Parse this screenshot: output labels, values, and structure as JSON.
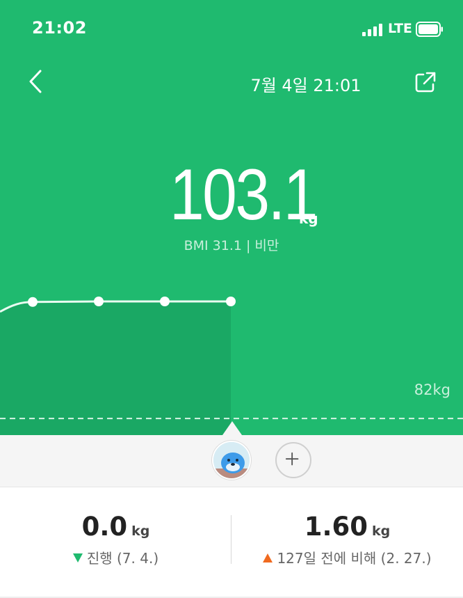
{
  "status_bar": {
    "time": "21:02",
    "network": "LTE"
  },
  "nav": {
    "back_icon": "chevron-left-icon",
    "title": "7월 4일 21:01",
    "share_icon": "share-external-icon"
  },
  "measurement": {
    "weight_value": "103.1",
    "weight_unit": "kg",
    "bmi_text": "BMI 31.1 | 비만"
  },
  "chart_data": {
    "type": "line",
    "goal_label": "82kg",
    "goal_value": 82,
    "series": [
      {
        "values": [
          103.0,
          103.1,
          103.1,
          103.1
        ]
      }
    ],
    "selected_index": 3
  },
  "avatar_bar": {
    "avatar_icon": "user-avatar",
    "add_icon": "plus-icon"
  },
  "stats": {
    "left": {
      "value": "0.0",
      "unit": "kg",
      "caption": "진행 (7. 4.)",
      "trend_icon": "triangle-down-icon",
      "trend_color": "#1fba6f"
    },
    "right": {
      "value": "1.60",
      "unit": "kg",
      "caption": "127일 전에 비해 (2. 27.)",
      "trend_icon": "triangle-up-icon",
      "trend_color": "#f06a1f"
    }
  },
  "colors": {
    "brand_green": "#1fba6f",
    "chart_fill": "#1aa864"
  }
}
